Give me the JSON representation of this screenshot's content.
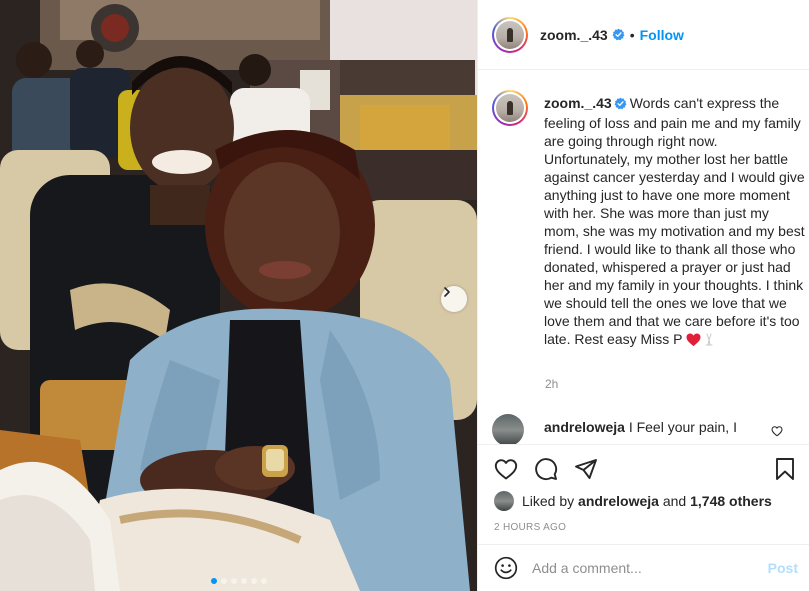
{
  "post": {
    "username": "zoom._.43",
    "verified": true,
    "follow_label": "Follow",
    "separator": "•",
    "caption_text": "Words can't express the feeling of loss and pain me and my family are going through right now. Unfortunately, my mother lost her battle against cancer yesterday and I would give anything just to have one more moment with her. She was more than just my mom, she was my motivation and my best friend. I would like to thank all those who donated, whispered a prayer or just had her and my family in your thoughts. I think we should tell the ones we love that we love them and that we care before it's too late. Rest easy Miss P",
    "caption_time": "2h",
    "comment": {
      "username": "andreloweja",
      "text": "I Feel your pain, I"
    },
    "liked_by_prefix": "Liked by",
    "liked_by_user": "andreloweja",
    "liked_by_and": "and",
    "liked_by_others": "1,748 others",
    "post_time": "2 HOURS AGO",
    "comment_placeholder": "Add a comment...",
    "post_label": "Post"
  },
  "carousel": {
    "slides": 6,
    "active_index": 0
  },
  "icons": {
    "verified": "verified-badge-icon",
    "like": "heart-icon",
    "comment": "comment-icon",
    "share": "share-icon",
    "save": "bookmark-icon",
    "emoji": "emoji-icon",
    "next": "chevron-right-icon",
    "caption_emoji_1": "red-heart-icon",
    "caption_emoji_2": "praying-hands-icon"
  },
  "colors": {
    "accent": "#0095f6",
    "text": "#262626",
    "muted": "#8e8e8e",
    "post_disabled": "#b2dffc",
    "border": "#efefef"
  }
}
